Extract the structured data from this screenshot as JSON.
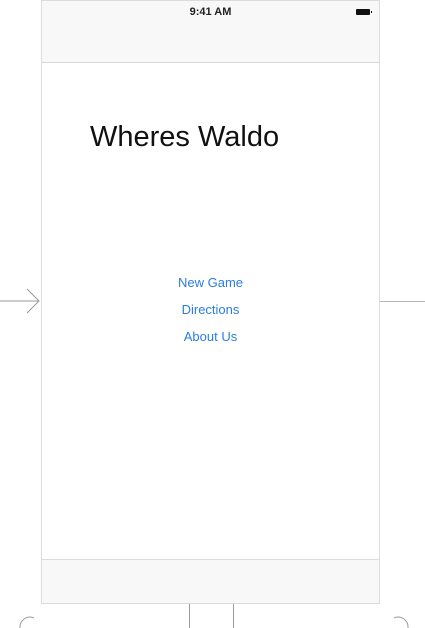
{
  "status_bar": {
    "time": "9:41 AM",
    "battery_icon": "battery-full-icon"
  },
  "title": "Wheres Waldo",
  "menu": {
    "items": [
      {
        "label": "New Game"
      },
      {
        "label": "Directions"
      },
      {
        "label": "About Us"
      }
    ]
  },
  "colors": {
    "link": "#2a7de1",
    "bar_background": "#f8f8f8",
    "border": "#dcdcdc"
  }
}
